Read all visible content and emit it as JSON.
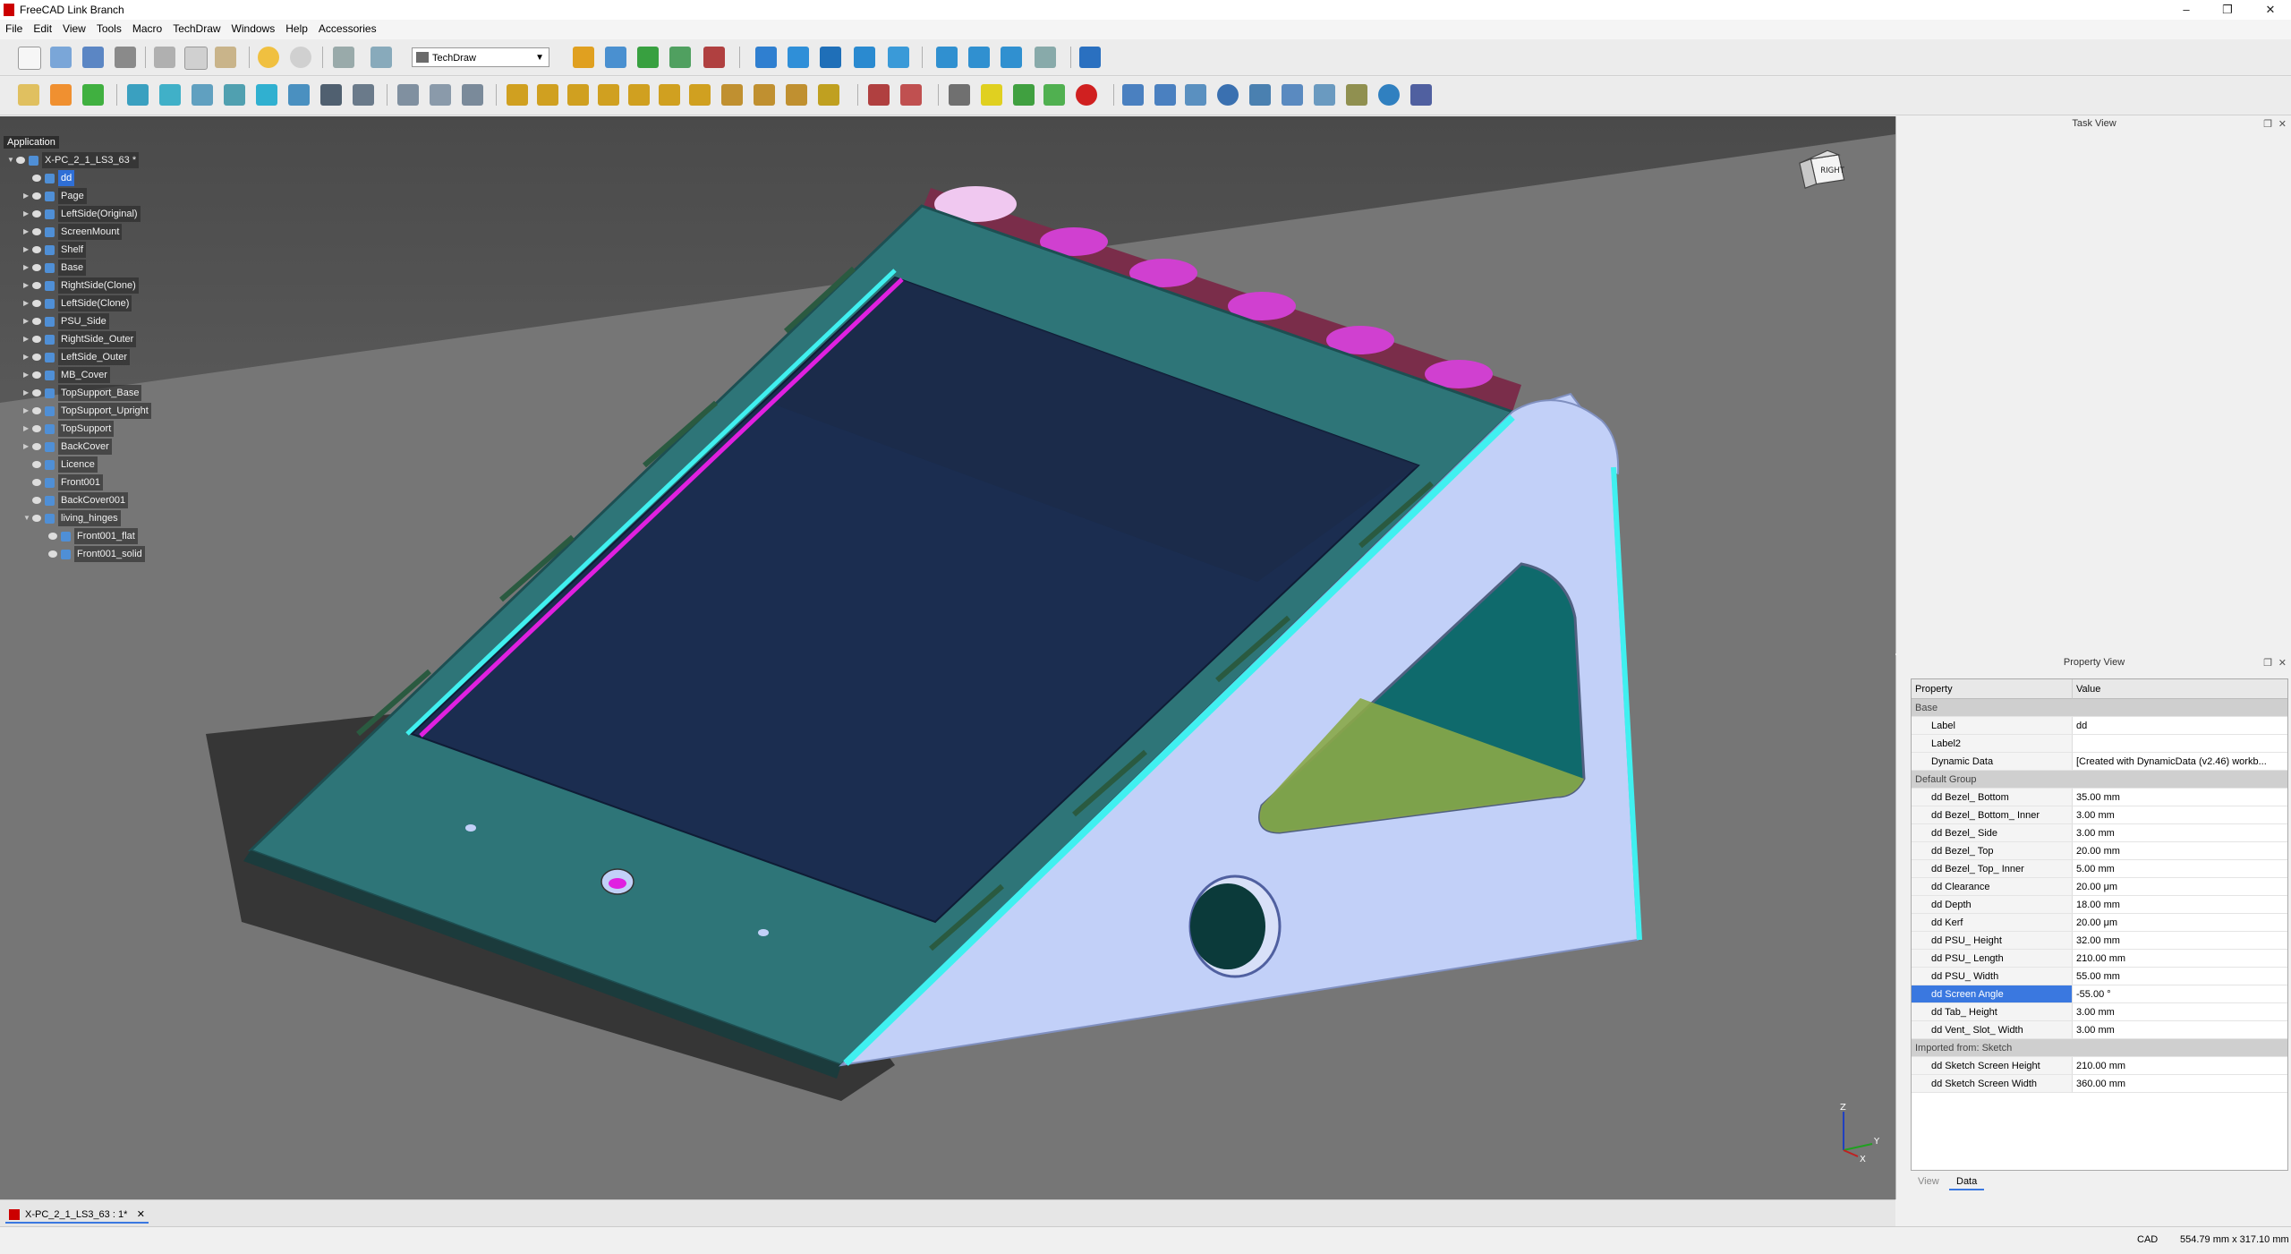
{
  "window": {
    "title": "FreeCAD Link Branch",
    "controls": [
      "–",
      "❐",
      "✕"
    ]
  },
  "menu": [
    "File",
    "Edit",
    "View",
    "Tools",
    "Macro",
    "TechDraw",
    "Windows",
    "Help",
    "Accessories"
  ],
  "workbench": {
    "selected": "TechDraw"
  },
  "tree": {
    "header": "Application",
    "rows": [
      {
        "label": "X-PC_2_1_LS3_63 *",
        "level": 0,
        "arrow": "▼",
        "sel": false
      },
      {
        "label": "dd",
        "level": 1,
        "arrow": "",
        "sel": true
      },
      {
        "label": "Page",
        "level": 1,
        "arrow": "▶",
        "sel": false
      },
      {
        "label": "LeftSide(Original)",
        "level": 1,
        "arrow": "▶",
        "sel": false
      },
      {
        "label": "ScreenMount",
        "level": 1,
        "arrow": "▶",
        "sel": false
      },
      {
        "label": "Shelf",
        "level": 1,
        "arrow": "▶",
        "sel": false
      },
      {
        "label": "Base",
        "level": 1,
        "arrow": "▶",
        "sel": false
      },
      {
        "label": "RightSide(Clone)",
        "level": 1,
        "arrow": "▶",
        "sel": false
      },
      {
        "label": "LeftSide(Clone)",
        "level": 1,
        "arrow": "▶",
        "sel": false
      },
      {
        "label": "PSU_Side",
        "level": 1,
        "arrow": "▶",
        "sel": false
      },
      {
        "label": "RightSide_Outer",
        "level": 1,
        "arrow": "▶",
        "sel": false
      },
      {
        "label": "LeftSide_Outer",
        "level": 1,
        "arrow": "▶",
        "sel": false
      },
      {
        "label": "MB_Cover",
        "level": 1,
        "arrow": "▶",
        "sel": false
      },
      {
        "label": "TopSupport_Base",
        "level": 1,
        "arrow": "▶",
        "sel": false
      },
      {
        "label": "TopSupport_Upright",
        "level": 1,
        "arrow": "▶",
        "sel": false
      },
      {
        "label": "TopSupport",
        "level": 1,
        "arrow": "▶",
        "sel": false
      },
      {
        "label": "BackCover",
        "level": 1,
        "arrow": "▶",
        "sel": false
      },
      {
        "label": "Licence",
        "level": 1,
        "arrow": "",
        "sel": false
      },
      {
        "label": "Front001",
        "level": 1,
        "arrow": "",
        "sel": false
      },
      {
        "label": "BackCover001",
        "level": 1,
        "arrow": "",
        "sel": false
      },
      {
        "label": "living_hinges",
        "level": 1,
        "arrow": "▼",
        "sel": false
      },
      {
        "label": "Front001_flat",
        "level": 2,
        "arrow": "",
        "sel": false
      },
      {
        "label": "Front001_solid",
        "level": 2,
        "arrow": "",
        "sel": false
      }
    ]
  },
  "navcube": {
    "face": "RIGHT"
  },
  "axis": {
    "z": "Z",
    "y": "Y",
    "x": "X"
  },
  "taskview": {
    "title": "Task View"
  },
  "propview": {
    "title": "Property View",
    "col_property": "Property",
    "col_value": "Value",
    "rows": [
      {
        "name": "Base",
        "value": "",
        "group": true
      },
      {
        "name": "Label",
        "value": "dd"
      },
      {
        "name": "Label2",
        "value": ""
      },
      {
        "name": "Dynamic Data",
        "value": "[Created with DynamicData (v2.46) workb..."
      },
      {
        "name": "Default Group",
        "value": "",
        "group": true
      },
      {
        "name": "dd Bezel_ Bottom",
        "value": "35.00 mm"
      },
      {
        "name": "dd Bezel_ Bottom_ Inner",
        "value": "3.00 mm"
      },
      {
        "name": "dd Bezel_ Side",
        "value": "3.00 mm"
      },
      {
        "name": "dd Bezel_ Top",
        "value": "20.00 mm"
      },
      {
        "name": "dd Bezel_ Top_ Inner",
        "value": "5.00 mm"
      },
      {
        "name": "dd Clearance",
        "value": "20.00 μm"
      },
      {
        "name": "dd Depth",
        "value": "18.00 mm"
      },
      {
        "name": "dd Kerf",
        "value": "20.00 μm"
      },
      {
        "name": "dd PSU_ Height",
        "value": "32.00 mm"
      },
      {
        "name": "dd PSU_ Length",
        "value": "210.00 mm"
      },
      {
        "name": "dd PSU_ Width",
        "value": "55.00 mm"
      },
      {
        "name": "dd Screen Angle",
        "value": "-55.00 °",
        "sel": true
      },
      {
        "name": "dd Tab_ Height",
        "value": "3.00 mm"
      },
      {
        "name": "dd Vent_ Slot_ Width",
        "value": "3.00 mm"
      },
      {
        "name": "Imported from: Sketch",
        "value": "",
        "group": true
      },
      {
        "name": "dd Sketch Screen Height",
        "value": "210.00 mm"
      },
      {
        "name": "dd Sketch Screen Width",
        "value": "360.00 mm"
      }
    ],
    "tabs": [
      "View",
      "Data"
    ],
    "active_tab": "Data"
  },
  "doctab": {
    "label": "X-PC_2_1_LS3_63 : 1*",
    "close": "✕"
  },
  "status": {
    "nav": "CAD",
    "dimensions": "554.79 mm x 317.10 mm"
  },
  "colors": {
    "teal_panel": "#2e7578",
    "side_panel": "#c2d0f8",
    "screen": "#1b2d50",
    "cyan_edge": "#40f0f0",
    "magenta": "#e020e0",
    "accent": "#3a78e0"
  }
}
